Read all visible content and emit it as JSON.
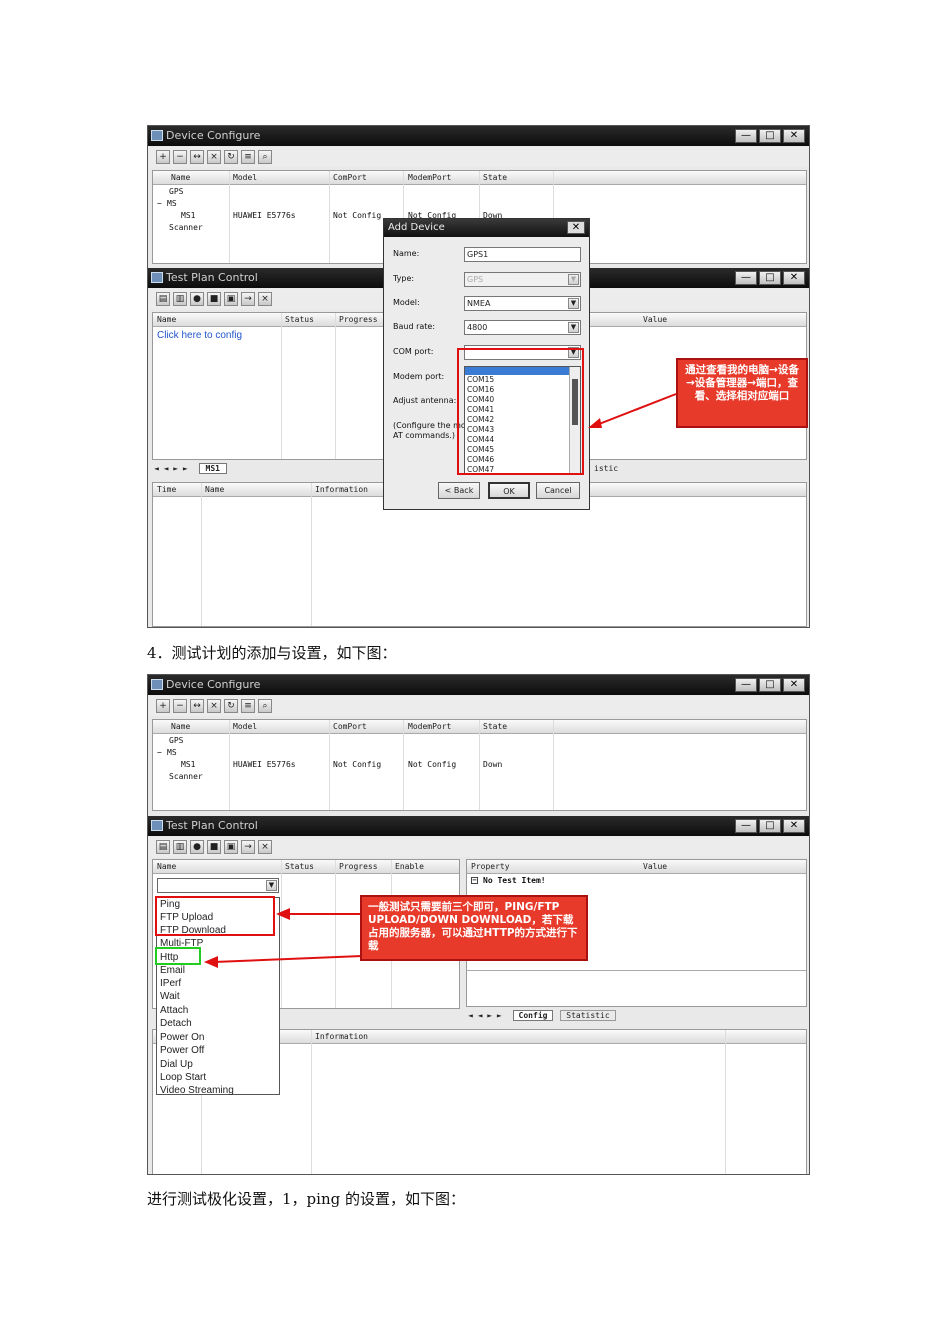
{
  "shot1": {
    "device_window": {
      "title": "Device Configure",
      "columns": [
        "Name",
        "Model",
        "ComPort",
        "ModemPort",
        "State"
      ],
      "rows": [
        {
          "name": "GPS",
          "model": "",
          "comport": "",
          "modemport": "",
          "state": ""
        },
        {
          "name": "MS",
          "model": "",
          "comport": "",
          "modemport": "",
          "state": ""
        },
        {
          "name": "MS1",
          "model": "HUAWEI E5776s",
          "comport": "Not Config",
          "modemport": "Not Config",
          "state": "Down"
        },
        {
          "name": "Scanner",
          "model": "",
          "comport": "",
          "modemport": "",
          "state": ""
        }
      ],
      "tree_toggle": "−"
    },
    "testplan_window": {
      "title": "Test Plan Control",
      "columns": [
        "Name",
        "Status",
        "Progress"
      ],
      "link": "Click here to config",
      "property_header": "Value",
      "tab_nav": "◄ ◄ ► ►",
      "tab_label": "MS1",
      "tab_statistic_partial": "istic",
      "log_columns": [
        "Time",
        "Name",
        "Information"
      ]
    },
    "add_device_dialog": {
      "title": "Add Device",
      "close": "✕",
      "labels": {
        "name": "Name:",
        "type": "Type:",
        "model": "Model:",
        "baud": "Baud rate:",
        "com": "COM port:",
        "modem": "Modem port:",
        "antenna": "Adjust antenna:",
        "config_note_1": "(Configure the mo",
        "config_note_2": "AT commands.)"
      },
      "values": {
        "name": "GPS1",
        "type": "GPS",
        "model": "NMEA",
        "baud": "4800"
      },
      "com_options": [
        "COM15",
        "COM16",
        "COM40",
        "COM41",
        "COM42",
        "COM43",
        "COM44",
        "COM45",
        "COM46",
        "COM47"
      ],
      "buttons": {
        "back": "< Back",
        "ok": "OK",
        "cancel": "Cancel"
      }
    },
    "callout": "通过查看我的电脑→设备→设备管理器→端口，查看、选择相对应端口"
  },
  "caption1": "4．测试计划的添加与设置，如下图：",
  "shot2": {
    "device_window": {
      "title": "Device Configure",
      "columns": [
        "Name",
        "Model",
        "ComPort",
        "ModemPort",
        "State"
      ],
      "rows": [
        {
          "name": "GPS",
          "model": "",
          "comport": "",
          "modemport": "",
          "state": ""
        },
        {
          "name": "MS",
          "model": "",
          "comport": "",
          "modemport": "",
          "state": ""
        },
        {
          "name": "MS1",
          "model": "HUAWEI E5776s",
          "comport": "Not Config",
          "modemport": "Not Config",
          "state": "Down"
        },
        {
          "name": "Scanner",
          "model": "",
          "comport": "",
          "modemport": "",
          "state": ""
        }
      ]
    },
    "testplan_window": {
      "title": "Test Plan Control",
      "columns": [
        "Name",
        "Status",
        "Progress",
        "Enable"
      ],
      "property_columns": [
        "Property",
        "Value"
      ],
      "property_row": "No Test Item!",
      "tab_nav": "◄ ◄ ► ►",
      "tab_config": "Config",
      "tab_statistic": "Statistic",
      "log_columns": [
        "Information"
      ],
      "menu_items": [
        "Ping",
        "FTP Upload",
        "FTP Download",
        "Multi-FTP",
        "Http",
        "Email",
        "IPerf",
        "Wait",
        "Attach",
        "Detach",
        "Power On",
        "Power Off",
        "Dial Up",
        "Loop Start",
        "Video Streaming"
      ]
    },
    "callout": "一般测试只需要前三个即可，PING/FTP UPLOAD/DOWN DOWNLOAD，若下载占用的服务器，可以通过HTTP的方式进行下载"
  },
  "caption2": "进行测试极化设置，1，ping 的设置，如下图：",
  "window_buttons": {
    "min": "—",
    "max": "□",
    "close": "✕"
  }
}
